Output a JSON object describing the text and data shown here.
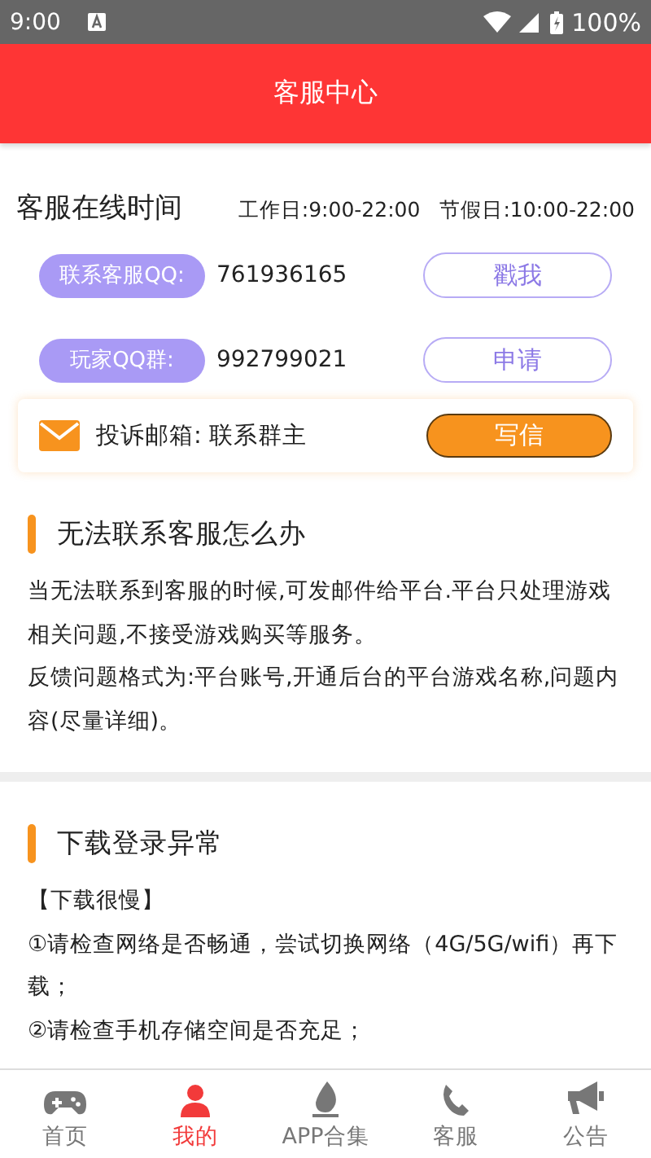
{
  "status_bar": {
    "time": "9:00",
    "battery": "100%"
  },
  "header": {
    "title": "客服中心"
  },
  "online_time": {
    "title": "客服在线时间",
    "workday": "工作日:9:00-22:00",
    "holiday": "节假日:10:00-22:00"
  },
  "contacts": [
    {
      "label": "联系客服QQ:",
      "number": "761936165",
      "button": "戳我"
    },
    {
      "label": "玩家QQ群:",
      "number": "992799021",
      "button": "申请"
    }
  ],
  "email": {
    "text": "投诉邮箱: 联系群主",
    "button": "写信"
  },
  "sections": [
    {
      "title": "无法联系客服怎么办",
      "paragraphs": [
        "当无法联系到客服的时候,可发邮件给平台.平台只处理游戏相关问题,不接受游戏购买等服务。",
        "反馈问题格式为:平台账号,开通后台的平台游戏名称,问题内容(尽量详细)。"
      ]
    },
    {
      "title": "下载登录异常",
      "paragraphs": [
        "【下载很慢】",
        "①请检查网络是否畅通，尝试切换网络（4G/5G/wifi）再下载；",
        "②请检查手机存储空间是否充足；"
      ]
    }
  ],
  "tabs": [
    {
      "kind": "gamepad",
      "label": "首页",
      "selected": false
    },
    {
      "kind": "person",
      "label": "我的",
      "selected": true
    },
    {
      "kind": "flame",
      "label": "APP合集",
      "selected": false
    },
    {
      "kind": "phone",
      "label": "客服",
      "selected": false
    },
    {
      "kind": "megaphone",
      "label": "公告",
      "selected": false
    }
  ]
}
